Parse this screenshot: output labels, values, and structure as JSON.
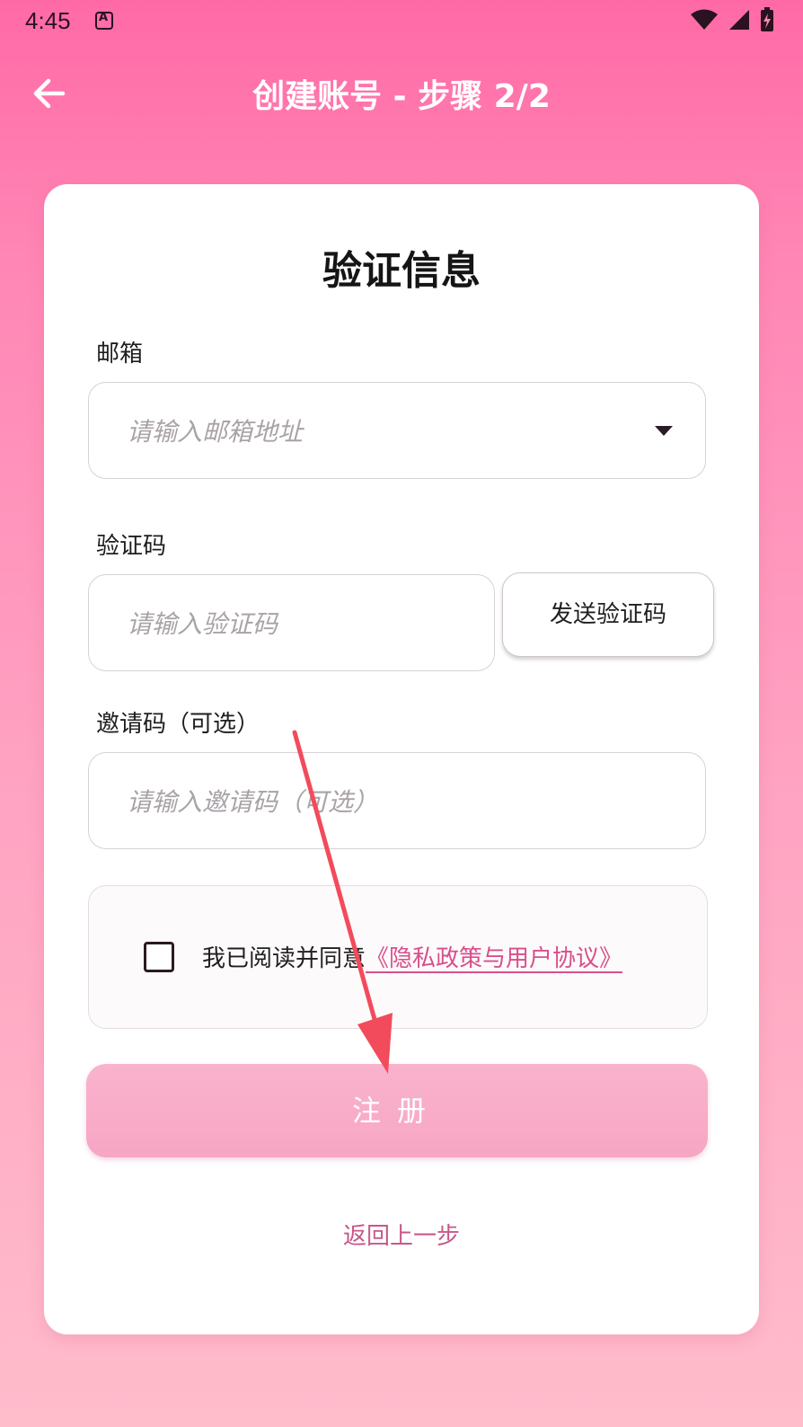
{
  "status_bar": {
    "time": "4:45",
    "icons": [
      "app-icon",
      "wifi-icon",
      "signal-icon",
      "battery-charging-icon"
    ]
  },
  "app_bar": {
    "title": "创建账号 - 步骤 2/2",
    "back_icon": "arrow-left-icon"
  },
  "form": {
    "title": "验证信息",
    "email": {
      "label": "邮箱",
      "placeholder": "请输入邮箱地址",
      "value": ""
    },
    "code": {
      "label": "验证码",
      "placeholder": "请输入验证码",
      "value": "",
      "send_label": "发送验证码"
    },
    "invite": {
      "label": "邀请码（可选）",
      "placeholder": "请输入邀请码（可选）",
      "value": ""
    },
    "agreement": {
      "checked": false,
      "prefix": "我已阅读并同意",
      "link": "《隐私政策与用户协议》"
    },
    "register_label": "注册",
    "back_step_label": "返回上一步"
  },
  "colors": {
    "accent": "#ff6aa6",
    "link": "#d94f8c",
    "button": "#f7a6c4",
    "annotation": "#f24b5c"
  }
}
